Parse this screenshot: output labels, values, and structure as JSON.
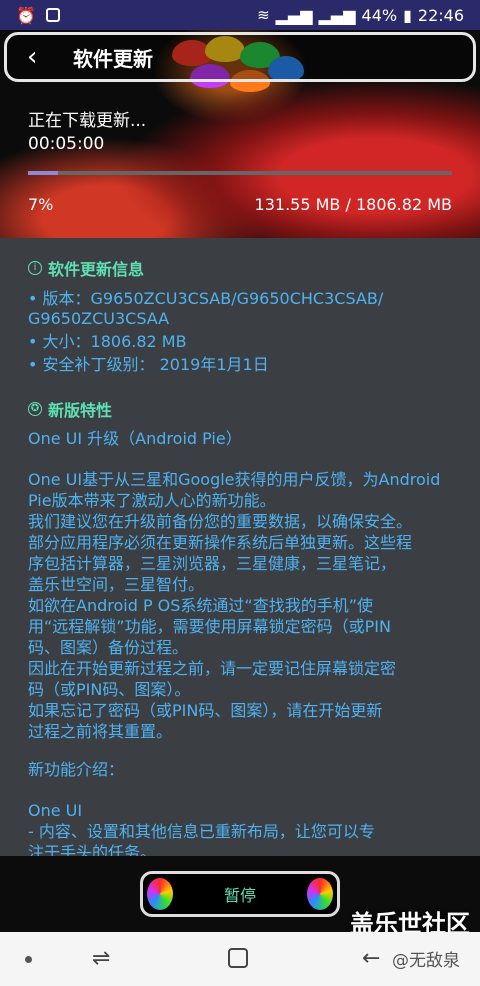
{
  "status_bar": {
    "battery": "44%",
    "time": "22:46",
    "left_icons": [
      "alarm-icon",
      "screenshot-icon"
    ],
    "right_icons": [
      "wifi-icon",
      "signal-icon",
      "signal-icon",
      "battery-icon"
    ]
  },
  "header": {
    "title": "软件更新",
    "back_icon": "back-arrow-icon"
  },
  "download": {
    "status": "正在下载更新...",
    "elapsed": "00:05:00",
    "percent_label": "7%",
    "progress": 0.07,
    "size": "131.55 MB / 1806.82 MB"
  },
  "info": {
    "heading": "软件更新信息",
    "version_line1": "• 版本：G9650ZCU3CSAB/G9650CHC3CSAB/",
    "version_line2": "G9650ZCU3CSAA",
    "size_line": "• 大小：1806.82 MB",
    "patch_line": "• 安全补丁级别： 2019年1月1日"
  },
  "features": {
    "heading": "新版特性",
    "paragraph1": "One UI 升级（Android Pie）",
    "paragraph2_lines": [
      "One UI基于从三星和Google获得的用户反馈，为Android",
      "Pie版本带来了激动人心的新功能。",
      "我们建议您在升级前备份您的重要数据，以确保安全。",
      "部分应用程序必须在更新操作系统后单独更新。这些程",
      "序包括计算器，三星浏览器，三星健康，三星笔记，",
      "盖乐世空间，三星智付。",
      "如欲在Android P OS系统通过“查找我的手机”使",
      "用“远程解锁”功能，需要使用屏幕锁定密码（或PIN",
      "码、图案）备份过程。",
      "因此在开始更新过程之前，请一定要记住屏幕锁定密",
      "码（或PIN码、图案）。",
      "如果忘记了密码（或PIN码、图案），请在开始更新",
      "过程之前将其重置。"
    ],
    "intro": "新功能介绍：",
    "one_ui": "One UI",
    "bullet_lines": [
      "- 内容、设置和其他信息已重新布局，让您可以专",
      "注于手头的任务。"
    ]
  },
  "bottom": {
    "pause_label": "暂停",
    "watermark": "盖乐世社区"
  },
  "navbar": {
    "credit": "@无敌泉"
  },
  "colors": {
    "accent_teal": "#5fe0b3",
    "text_blue": "#4fb2f0",
    "panel_bg": "#3b3f43",
    "status_bar": "#2a2a6a"
  }
}
